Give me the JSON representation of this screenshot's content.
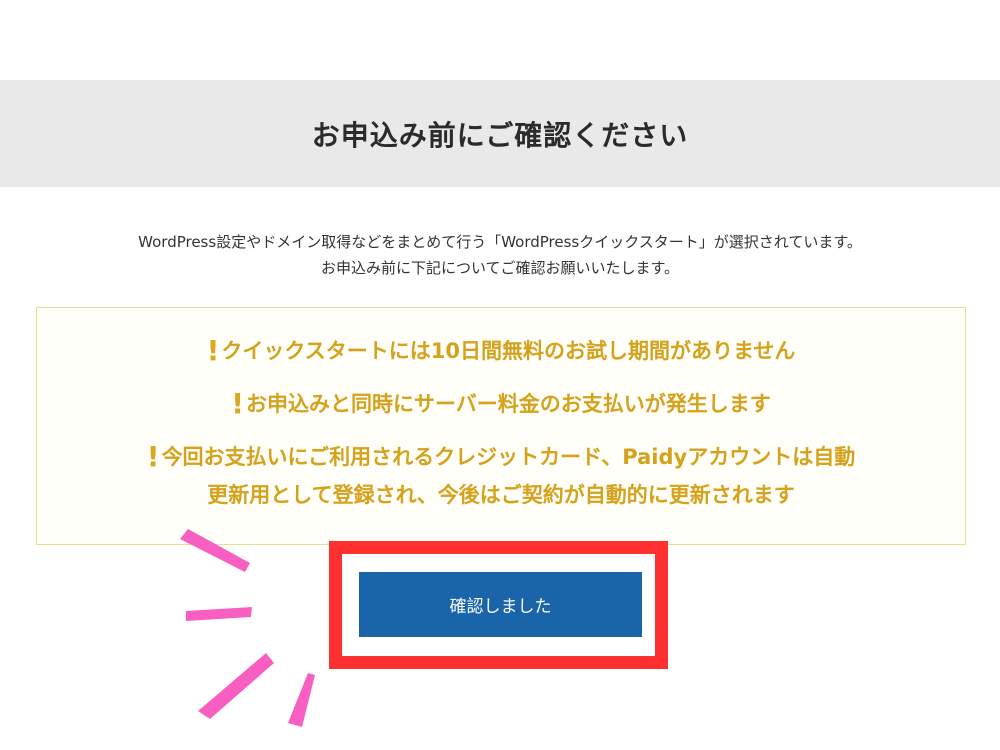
{
  "header": {
    "title": "お申込み前にご確認ください"
  },
  "intro": {
    "line1": "WordPress設定やドメイン取得などをまとめて行う「WordPressクイックスタート」が選択されています。",
    "line2": "お申込み前に下記についてご確認お願いいたします。"
  },
  "warnings": {
    "mark": "!",
    "items": [
      "クイックスタートには10日間無料のお試し期間がありません",
      "お申込みと同時にサーバー料金のお支払いが発生します",
      "今回お支払いにご利用されるクレジットカード、Paidyアカウントは自動",
      "更新用として登録され、今後はご契約が自動的に更新されます"
    ]
  },
  "confirm": {
    "label": "確認しました"
  },
  "colors": {
    "header_bg": "#e9e9e9",
    "warning_text": "#d4a21b",
    "button_bg": "#1a64a9",
    "highlight_frame": "#ff3030",
    "burst": "#f85fc0"
  }
}
